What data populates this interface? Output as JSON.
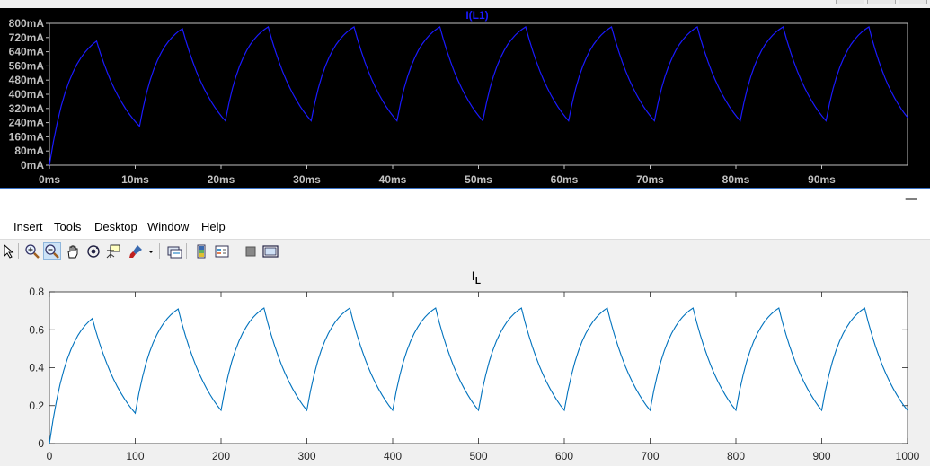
{
  "spice": {
    "trace_label": "I(L1)",
    "colors": {
      "background": "#000000",
      "trace": "#1a1aff",
      "axis_text": "#c0c0c0",
      "frame": "#c0c0c0"
    },
    "y_ticks": [
      "800mA",
      "720mA",
      "640mA",
      "560mA",
      "480mA",
      "400mA",
      "320mA",
      "240mA",
      "160mA",
      "80mA",
      "0mA"
    ],
    "x_ticks": [
      "0ms",
      "10ms",
      "20ms",
      "30ms",
      "40ms",
      "50ms",
      "60ms",
      "70ms",
      "80ms",
      "90ms"
    ]
  },
  "menu": {
    "items": [
      "Insert",
      "Tools",
      "Desktop",
      "Window",
      "Help"
    ]
  },
  "toolbar": {
    "icons": [
      "pointer-icon",
      "zoom-in-icon",
      "zoom-out-icon",
      "pan-hand-icon",
      "rotate-3d-icon",
      "data-cursor-icon",
      "brush-icon",
      "brush-dropdown-icon",
      "link-plot-icon",
      "insert-colorbar-icon",
      "insert-legend-icon",
      "hide-plot-tools-icon",
      "show-plot-tools-icon"
    ]
  },
  "matlab": {
    "title_main": "I",
    "title_sub": "L",
    "colors": {
      "axes_bg": "#ffffff",
      "figure_bg": "#f0f0f0",
      "line": "#0072bd"
    },
    "y_ticks": [
      "0.8",
      "0.6",
      "0.4",
      "0.2",
      "0"
    ],
    "x_ticks": [
      "0",
      "100",
      "200",
      "300",
      "400",
      "500",
      "600",
      "700",
      "800",
      "900",
      "1000"
    ]
  },
  "chart_data": [
    {
      "type": "line",
      "title": "I(L1)",
      "xlabel": "",
      "ylabel": "",
      "x_unit": "ms",
      "y_unit": "mA",
      "xlim": [
        0,
        100
      ],
      "ylim": [
        0,
        800
      ],
      "grid": false,
      "series": [
        {
          "name": "I(L1)",
          "x": [
            0,
            5.5,
            10.5,
            15.5,
            20.5,
            25.5,
            30.5,
            35.5,
            40.5,
            45.5,
            50.5,
            55.5,
            60.5,
            65.5,
            70.5,
            75.5,
            80.5,
            85.5,
            90.5,
            95.5,
            100
          ],
          "y": [
            0,
            700,
            220,
            770,
            250,
            780,
            250,
            780,
            250,
            780,
            250,
            780,
            250,
            780,
            250,
            780,
            250,
            780,
            250,
            780,
            270
          ]
        }
      ]
    },
    {
      "type": "line",
      "title": "I_L",
      "xlabel": "",
      "ylabel": "",
      "xlim": [
        0,
        1000
      ],
      "ylim": [
        0,
        0.8
      ],
      "grid": false,
      "series": [
        {
          "x": [
            0,
            50,
            100,
            150,
            200,
            250,
            300,
            350,
            400,
            450,
            500,
            550,
            600,
            650,
            700,
            750,
            800,
            850,
            900,
            950,
            1000
          ],
          "y": [
            0,
            0.66,
            0.16,
            0.71,
            0.175,
            0.715,
            0.175,
            0.715,
            0.175,
            0.715,
            0.175,
            0.715,
            0.175,
            0.715,
            0.175,
            0.715,
            0.175,
            0.715,
            0.175,
            0.715,
            0.175
          ]
        }
      ]
    }
  ]
}
